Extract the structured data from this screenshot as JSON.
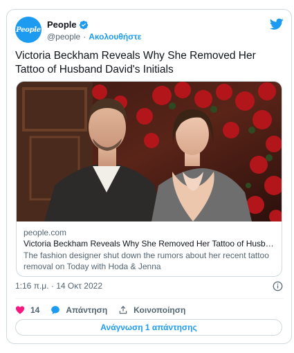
{
  "author": {
    "display_name": "People",
    "handle": "@people",
    "separator": "·",
    "follow_label": "Ακολουθήστε",
    "avatar_text": "People"
  },
  "tweet": {
    "text": "Victoria Beckham Reveals Why She Removed Her Tattoo of Husband David's Initials"
  },
  "link_card": {
    "domain": "people.com",
    "title": "Victoria Beckham Reveals Why She Removed Her Tattoo of Husband Da...",
    "description": "The fashion designer shut down the rumors about her recent tattoo removal on Today with Hoda & Jenna"
  },
  "meta": {
    "timestamp": "1:16 π.μ. · 14 Οκτ 2022"
  },
  "actions": {
    "like_count": "14",
    "reply_label": "Απάντηση",
    "share_label": "Κοινοποίηση"
  },
  "read_replies_label": "Ανάγνωση 1 απάντησης",
  "colors": {
    "accent": "#1d9bf0",
    "like": "#f91880",
    "secondary_text": "#536471",
    "border": "#cfd9de"
  },
  "icons": {
    "verified": "verified-badge-icon",
    "logo": "twitter-bird-icon",
    "like": "heart-icon",
    "reply": "speech-bubble-icon",
    "share": "share-arrow-icon",
    "info": "info-icon"
  }
}
